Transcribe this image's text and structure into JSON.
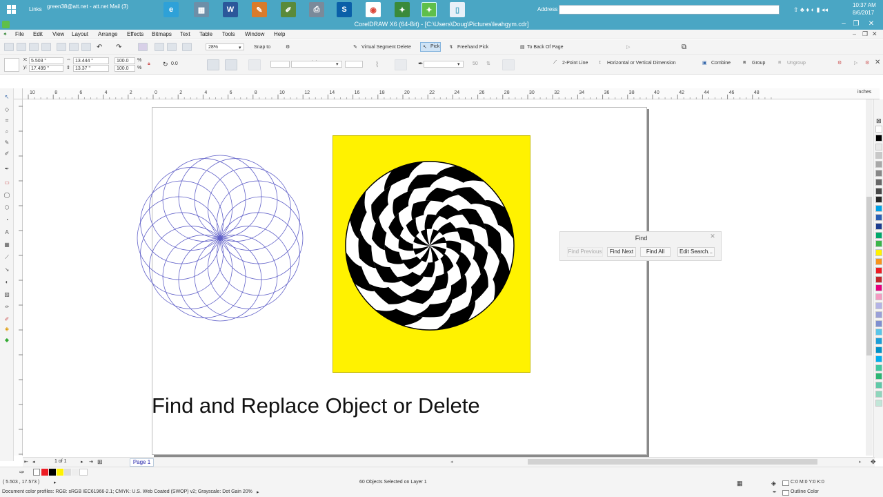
{
  "taskbar": {
    "links_label": "Links",
    "mail_label": "green38@att.net - att.net Mail (3)",
    "address_label": "Address",
    "clock_time": "10:37 AM",
    "clock_date": "8/6/2017"
  },
  "window": {
    "title": "CorelDRAW X6 (64-Bit) - [C:\\Users\\Doug\\Pictures\\leahgym.cdr]"
  },
  "menu": [
    "File",
    "Edit",
    "View",
    "Layout",
    "Arrange",
    "Effects",
    "Bitmaps",
    "Text",
    "Table",
    "Tools",
    "Window",
    "Help"
  ],
  "standard_toolbar": {
    "zoom": "28%",
    "snap_to": "Snap to",
    "virtual_segment_delete": "Virtual Segment Delete",
    "pick": "Pick",
    "freehand_pick": "Freehand Pick",
    "to_back_of_page": "To Back Of Page"
  },
  "property_bar": {
    "x": "5.503 \"",
    "y": "17.499 \"",
    "width": "13.444 \"",
    "height": "13.37 \"",
    "scale_x": "100.0",
    "scale_y": "100.0",
    "scale_unit": "%",
    "rotation": "0.0",
    "outline_width_placeholder": "50",
    "two_point_line": "2-Point Line",
    "dimension": "Horizontal or Vertical Dimension",
    "combine": "Combine",
    "group": "Group",
    "ungroup": "Ungroup"
  },
  "ruler_top_ticks": [
    "10",
    "8",
    "6",
    "4",
    "2",
    "0",
    "2",
    "4",
    "6",
    "8",
    "10",
    "12",
    "14",
    "16",
    "18",
    "20",
    "22",
    "24",
    "26",
    "28",
    "30",
    "32",
    "34",
    "36",
    "38",
    "40",
    "42",
    "44",
    "46",
    "48"
  ],
  "ruler_unit": "inches",
  "canvas": {
    "caption": "Find and Replace Object or Delete",
    "accent_yellow": "#fff200",
    "outline_color": "#6060c8"
  },
  "find_dialog": {
    "title": "Find",
    "find_previous": "Find Previous",
    "find_next": "Find Next",
    "find_all": "Find All",
    "edit_search": "Edit Search..."
  },
  "navigator": {
    "page_count": "1 of 1",
    "page_tab": "Page 1"
  },
  "status": {
    "cursor_position": "( 5.503 , 17.573 )",
    "selection_info": "60 Objects Selected on Layer 1",
    "fill_info": "C:0 M:0 Y:0 K:0",
    "outline_info": "Outline Color",
    "color_profiles": "Document color profiles: RGB: sRGB IEC61966-2.1; CMYK: U.S. Web Coated (SWOP) v2; Grayscale: Dot Gain 20%"
  },
  "palette_colors": [
    "#ffffff",
    "#000000",
    "#e8e8e8",
    "#c8c8c8",
    "#a8a8a8",
    "#888888",
    "#686868",
    "#484848",
    "#282828",
    "#00a2e8",
    "#2b5fb4",
    "#1d3d8f",
    "#00a86b",
    "#3cb54a",
    "#fff200",
    "#f7941d",
    "#ed1c24",
    "#c1272d",
    "#e6007e",
    "#f49ac1",
    "#b3b3e6",
    "#9aa0d8",
    "#7f8fd0",
    "#59c5e8",
    "#1b9ed8",
    "#0091c8",
    "#00aeef",
    "#41c8a0",
    "#2bb673",
    "#5fc9a8",
    "#8fd6bc",
    "#c2e6d8"
  ]
}
